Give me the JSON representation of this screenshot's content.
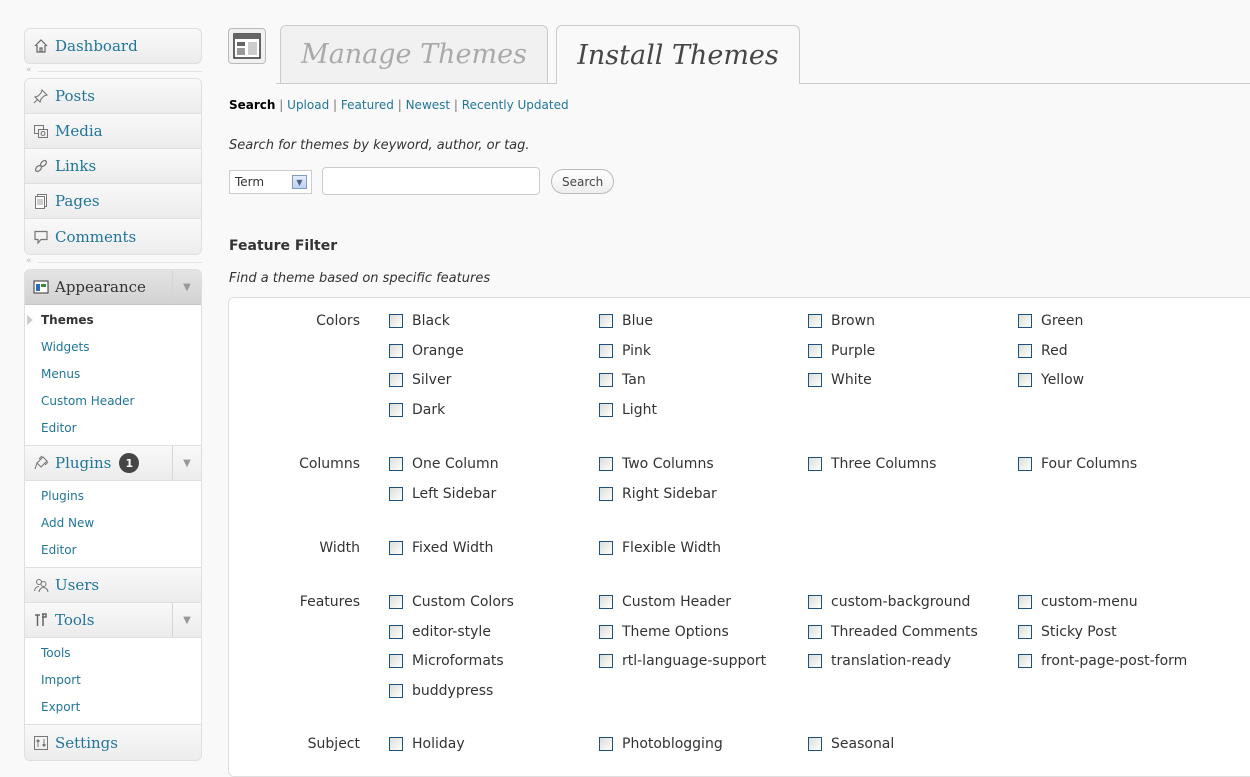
{
  "sidebar": {
    "dashboard": "Dashboard",
    "collapse_glyph": "«",
    "posts": "Posts",
    "media": "Media",
    "links": "Links",
    "pages": "Pages",
    "comments": "Comments",
    "appearance": {
      "label": "Appearance",
      "items": [
        "Themes",
        "Widgets",
        "Menus",
        "Custom Header",
        "Editor"
      ]
    },
    "plugins": {
      "label": "Plugins",
      "badge": "1",
      "items": [
        "Plugins",
        "Add New",
        "Editor"
      ]
    },
    "users": "Users",
    "tools": {
      "label": "Tools",
      "items": [
        "Tools",
        "Import",
        "Export"
      ]
    },
    "settings": "Settings"
  },
  "tabs": {
    "manage": "Manage Themes",
    "install": "Install Themes"
  },
  "subnav": {
    "search": "Search",
    "upload": "Upload",
    "featured": "Featured",
    "newest": "Newest",
    "recently_updated": "Recently Updated",
    "separator": "|"
  },
  "search": {
    "description": "Search for themes by keyword, author, or tag.",
    "type_selected": "Term",
    "value": "",
    "button": "Search"
  },
  "feature_filter": {
    "title": "Feature Filter",
    "description": "Find a theme based on specific features",
    "groups": {
      "colors": {
        "label": "Colors",
        "options": [
          "Black",
          "Blue",
          "Brown",
          "Green",
          "Orange",
          "Pink",
          "Purple",
          "Red",
          "Silver",
          "Tan",
          "White",
          "Yellow",
          "Dark",
          "Light"
        ]
      },
      "columns": {
        "label": "Columns",
        "options": [
          "One Column",
          "Two Columns",
          "Three Columns",
          "Four Columns",
          "Left Sidebar",
          "Right Sidebar"
        ]
      },
      "width": {
        "label": "Width",
        "options": [
          "Fixed Width",
          "Flexible Width"
        ]
      },
      "features": {
        "label": "Features",
        "options": [
          "Custom Colors",
          "Custom Header",
          "custom-background",
          "custom-menu",
          "editor-style",
          "Theme Options",
          "Threaded Comments",
          "Sticky Post",
          "Microformats",
          "rtl-language-support",
          "translation-ready",
          "front-page-post-form",
          "buddypress"
        ]
      },
      "subject": {
        "label": "Subject",
        "options": [
          "Holiday",
          "Photoblogging",
          "Seasonal"
        ]
      }
    }
  },
  "colors": {
    "link": "#21759b",
    "badge": "#464646",
    "border": "#dfdfdf"
  },
  "icons": [
    "home-icon",
    "pushpin-icon",
    "media-icon",
    "links-icon",
    "pages-icon",
    "comment-icon",
    "appearance-icon",
    "plugins-icon",
    "users-icon",
    "tools-icon",
    "settings-icon",
    "themes-header-icon"
  ]
}
